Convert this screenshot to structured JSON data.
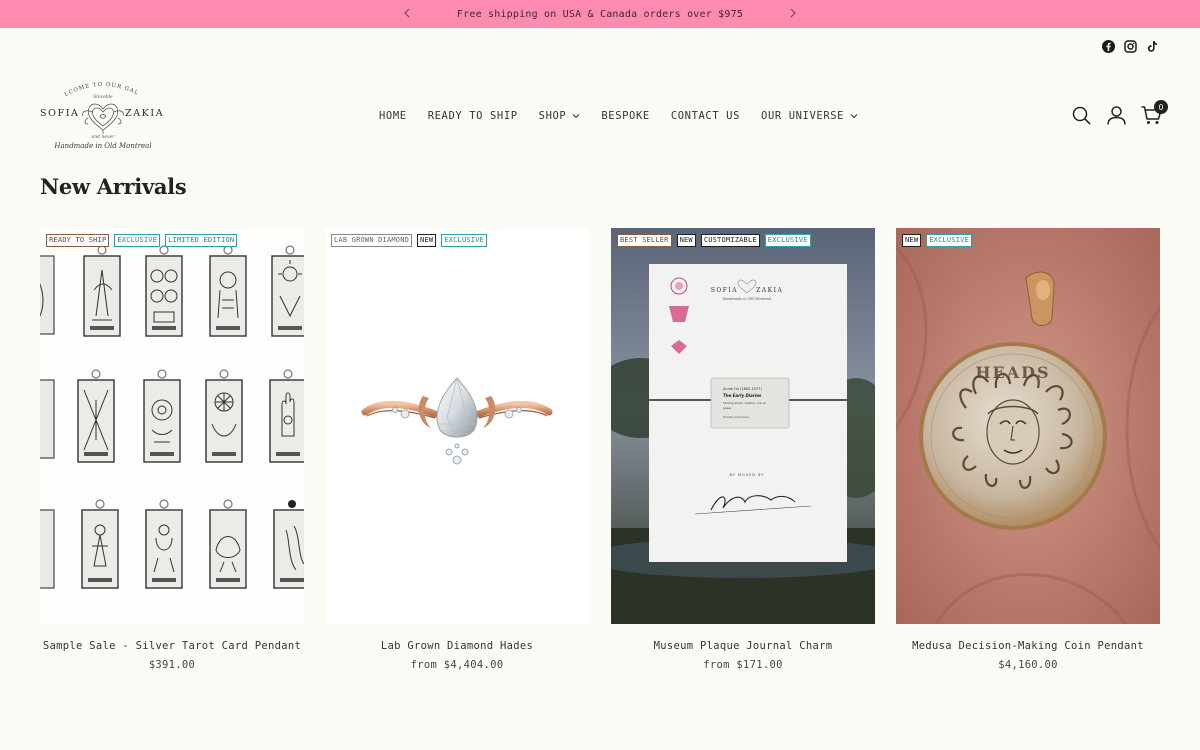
{
  "announcement": {
    "text": "Free shipping on USA & Canada orders over $975"
  },
  "social": [
    "facebook-icon",
    "instagram-icon",
    "tiktok-icon"
  ],
  "logo": {
    "top": "WELCOME TO OUR GALAXY",
    "sub": "Sinceble",
    "left": "SOFIA",
    "right": "ZAKIA",
    "and": "and never",
    "bottom": "Handmade in Old Montreal"
  },
  "nav": {
    "items": [
      "HOME",
      "READY TO SHIP",
      "SHOP",
      "BESPOKE",
      "CONTACT US",
      "OUR UNIVERSE"
    ]
  },
  "header": {
    "cart_count": "0"
  },
  "section": {
    "title": "New Arrivals"
  },
  "products": [
    {
      "title": "Sample Sale - Silver Tarot Card Pendant",
      "price": "$391.00",
      "badges": [
        "READY TO SHIP",
        "EXCLUSIVE",
        "LIMITED EDITION"
      ]
    },
    {
      "title": "Lab Grown Diamond Hades",
      "price": "from $4,404.00",
      "badges": [
        "LAB GROWN DIAMOND",
        "NEW",
        "EXCLUSIVE"
      ]
    },
    {
      "title": "Museum Plaque Journal Charm",
      "price": "from $171.00",
      "badges": [
        "BEST SELLER",
        "NEW",
        "CUSTOMIZABLE",
        "EXCLUSIVE"
      ]
    },
    {
      "title": "Medusa Decision-Making Coin Pendant",
      "price": "$4,160.00",
      "badges": [
        "NEW",
        "EXCLUSIVE"
      ]
    }
  ],
  "journal_card": {
    "brand_left": "SOFIA",
    "brand_right": "ZAKIA",
    "plaque_title": "The Early Diaries",
    "signature_label": "BY MOVED BY"
  },
  "coin": {
    "text": "HEADS"
  },
  "colors": {
    "announcement_bg": "#ff8cb0",
    "page_bg": "#fbfbf6",
    "badge_teal": "#2aa0a8",
    "badge_brown": "#8b5a3c"
  }
}
